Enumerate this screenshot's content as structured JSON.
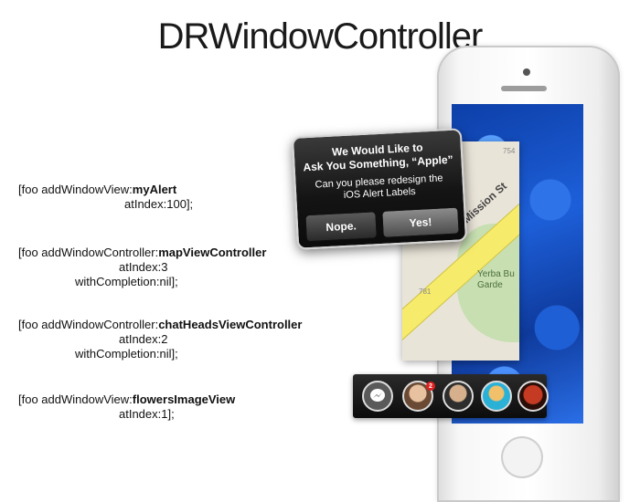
{
  "title": "DRWindowController",
  "code": [
    {
      "prefix": "[foo addWindowView:",
      "bold": "myAlert",
      "lines": [
        "atIndex:100];"
      ]
    },
    {
      "prefix": "[foo addWindowController:",
      "bold": "mapViewController",
      "lines": [
        "atIndex:3",
        "withCompletion:nil];"
      ]
    },
    {
      "prefix": "[foo addWindowController:",
      "bold": "chatHeadsViewController",
      "lines": [
        "atIndex:2",
        "withCompletion:nil];"
      ]
    },
    {
      "prefix": "[foo addWindowView:",
      "bold": "flowersImageView",
      "lines": [
        "atIndex:1];"
      ]
    }
  ],
  "alert": {
    "title": "We Would Like to\nAsk You Something, “Apple”",
    "message": "Can you please redesign the\niOS Alert Labels",
    "cancel_label": "Nope.",
    "confirm_label": "Yes!"
  },
  "map": {
    "street": "Mission St",
    "park": "Yerba Bu\nGarde",
    "numbers": [
      "754",
      "781"
    ]
  },
  "chat_heads": {
    "badge": "2",
    "icons": [
      "messenger-icon",
      "avatar",
      "avatar",
      "avatar",
      "avatar"
    ]
  }
}
